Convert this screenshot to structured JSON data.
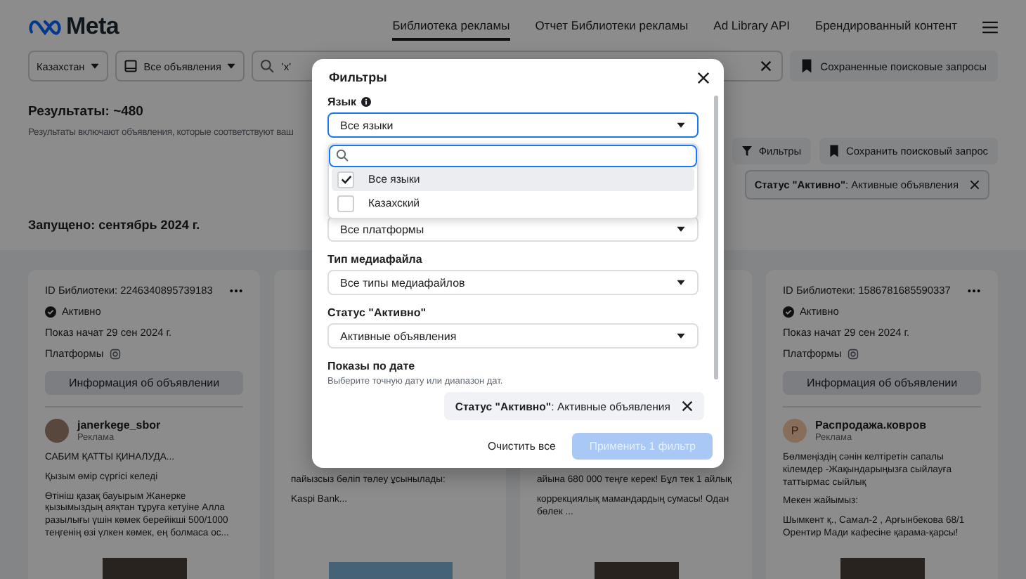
{
  "header": {
    "logo": "Meta",
    "nav": [
      {
        "label": "Библиотека рекламы",
        "selected": true
      },
      {
        "label": "Отчет Библиотеки рекламы",
        "selected": false
      },
      {
        "label": "Ad Library API",
        "selected": false
      },
      {
        "label": "Брендированный контент",
        "selected": false
      }
    ]
  },
  "toolbar": {
    "country": "Казахстан",
    "ad_type": "Все объявления",
    "search": "'x'",
    "saved_searches": "Сохраненные поисковые запросы"
  },
  "results": {
    "title": "Результаты: ~480",
    "subtitle": "Результаты включают объявления, которые соответствуют ваш",
    "filters_button": "Фильтры",
    "save_search_button": "Сохранить поисковый запрос",
    "chip": "**Статус \"Активно\"**: Активные объявления",
    "launched": "Запущено: сентябрь 2024 г."
  },
  "cards": [
    {
      "kind": "full",
      "library_id": "ID Библиотеки: 2246340895739183",
      "status": "Активно",
      "started": "Показ начат 29 сен 2024 г.",
      "platforms": "Платформы",
      "info_button": "Информация об объявлении",
      "advertiser": "janerkege_sbor",
      "sponsored": "Реклама",
      "body": [
        "САБИМ ҚАТТЫ ҚИНАЛУДА...",
        "Қызым өмір сүргісі келеді",
        "Өтініш қазақ бауырым Жанерке қызымыздың аяқтан тұруға кетуіне Алла разылығы үшін көмек берейікші 500/1000 теңгенің өзі үлкен көмек, ең болмаса ос..."
      ],
      "media": [
        {
          "kind": "video"
        }
      ]
    },
    {
      "kind": "covered",
      "body": [
        "пайызсыз бөліп төлеу ұсынылады:",
        "Kaspi Bank..."
      ],
      "media": [
        {
          "kind": "image"
        }
      ]
    },
    {
      "kind": "covered",
      "body": [
        "айына 680 000 теңге керек! Бұл тек 1 айлық",
        "коррекциялық мамандардың сумасы! Одан бөлек ..."
      ],
      "media": [
        {
          "kind": "video"
        }
      ]
    },
    {
      "kind": "full",
      "library_id": "ID Библиотеки: 1586781685590337",
      "status": "Активно",
      "started": "Показ начат 29 сен 2024 г.",
      "platforms": "Платформы",
      "info_button": "Информация об объявлении",
      "advertiser": "Распродажа.ковров",
      "avatar_letter": "Р",
      "sponsored": "Реклама",
      "body": [
        "Бөлмеңіздің сәнін келтіретін сапалы кілемдер -Жақындарыңызға сыйлауға таттырмас сыйлық",
        "Мекен жайымыз:",
        "Шымкент қ., Самал-2 , Арғынбекова 68/1 Орентир Мади кафесіне қарама-қарсы!"
      ],
      "media": [
        {
          "kind": "video"
        }
      ]
    }
  ],
  "modal": {
    "title": "Фильтры",
    "language_label": "Язык",
    "language_value": "Все языки",
    "language_dropdown": {
      "options": [
        {
          "label": "Все языки",
          "selected": true
        },
        {
          "label": "Казахский",
          "selected": false
        }
      ]
    },
    "platform_value": "Все платформы",
    "media_label": "Тип медиафайла",
    "media_value": "Все типы медиафайлов",
    "status_label": "Статус \"Активно\"",
    "status_value": "Активные объявления",
    "date_label": "Показы по дате",
    "date_hint": "Выберите точную дату или диапазон дат.",
    "chip": "**Статус \"Активно\"**: Активные объявления",
    "clear_button": "Очистить все",
    "apply_button": {
      "label": "Применить 1 фильтр",
      "disabled": true
    }
  }
}
